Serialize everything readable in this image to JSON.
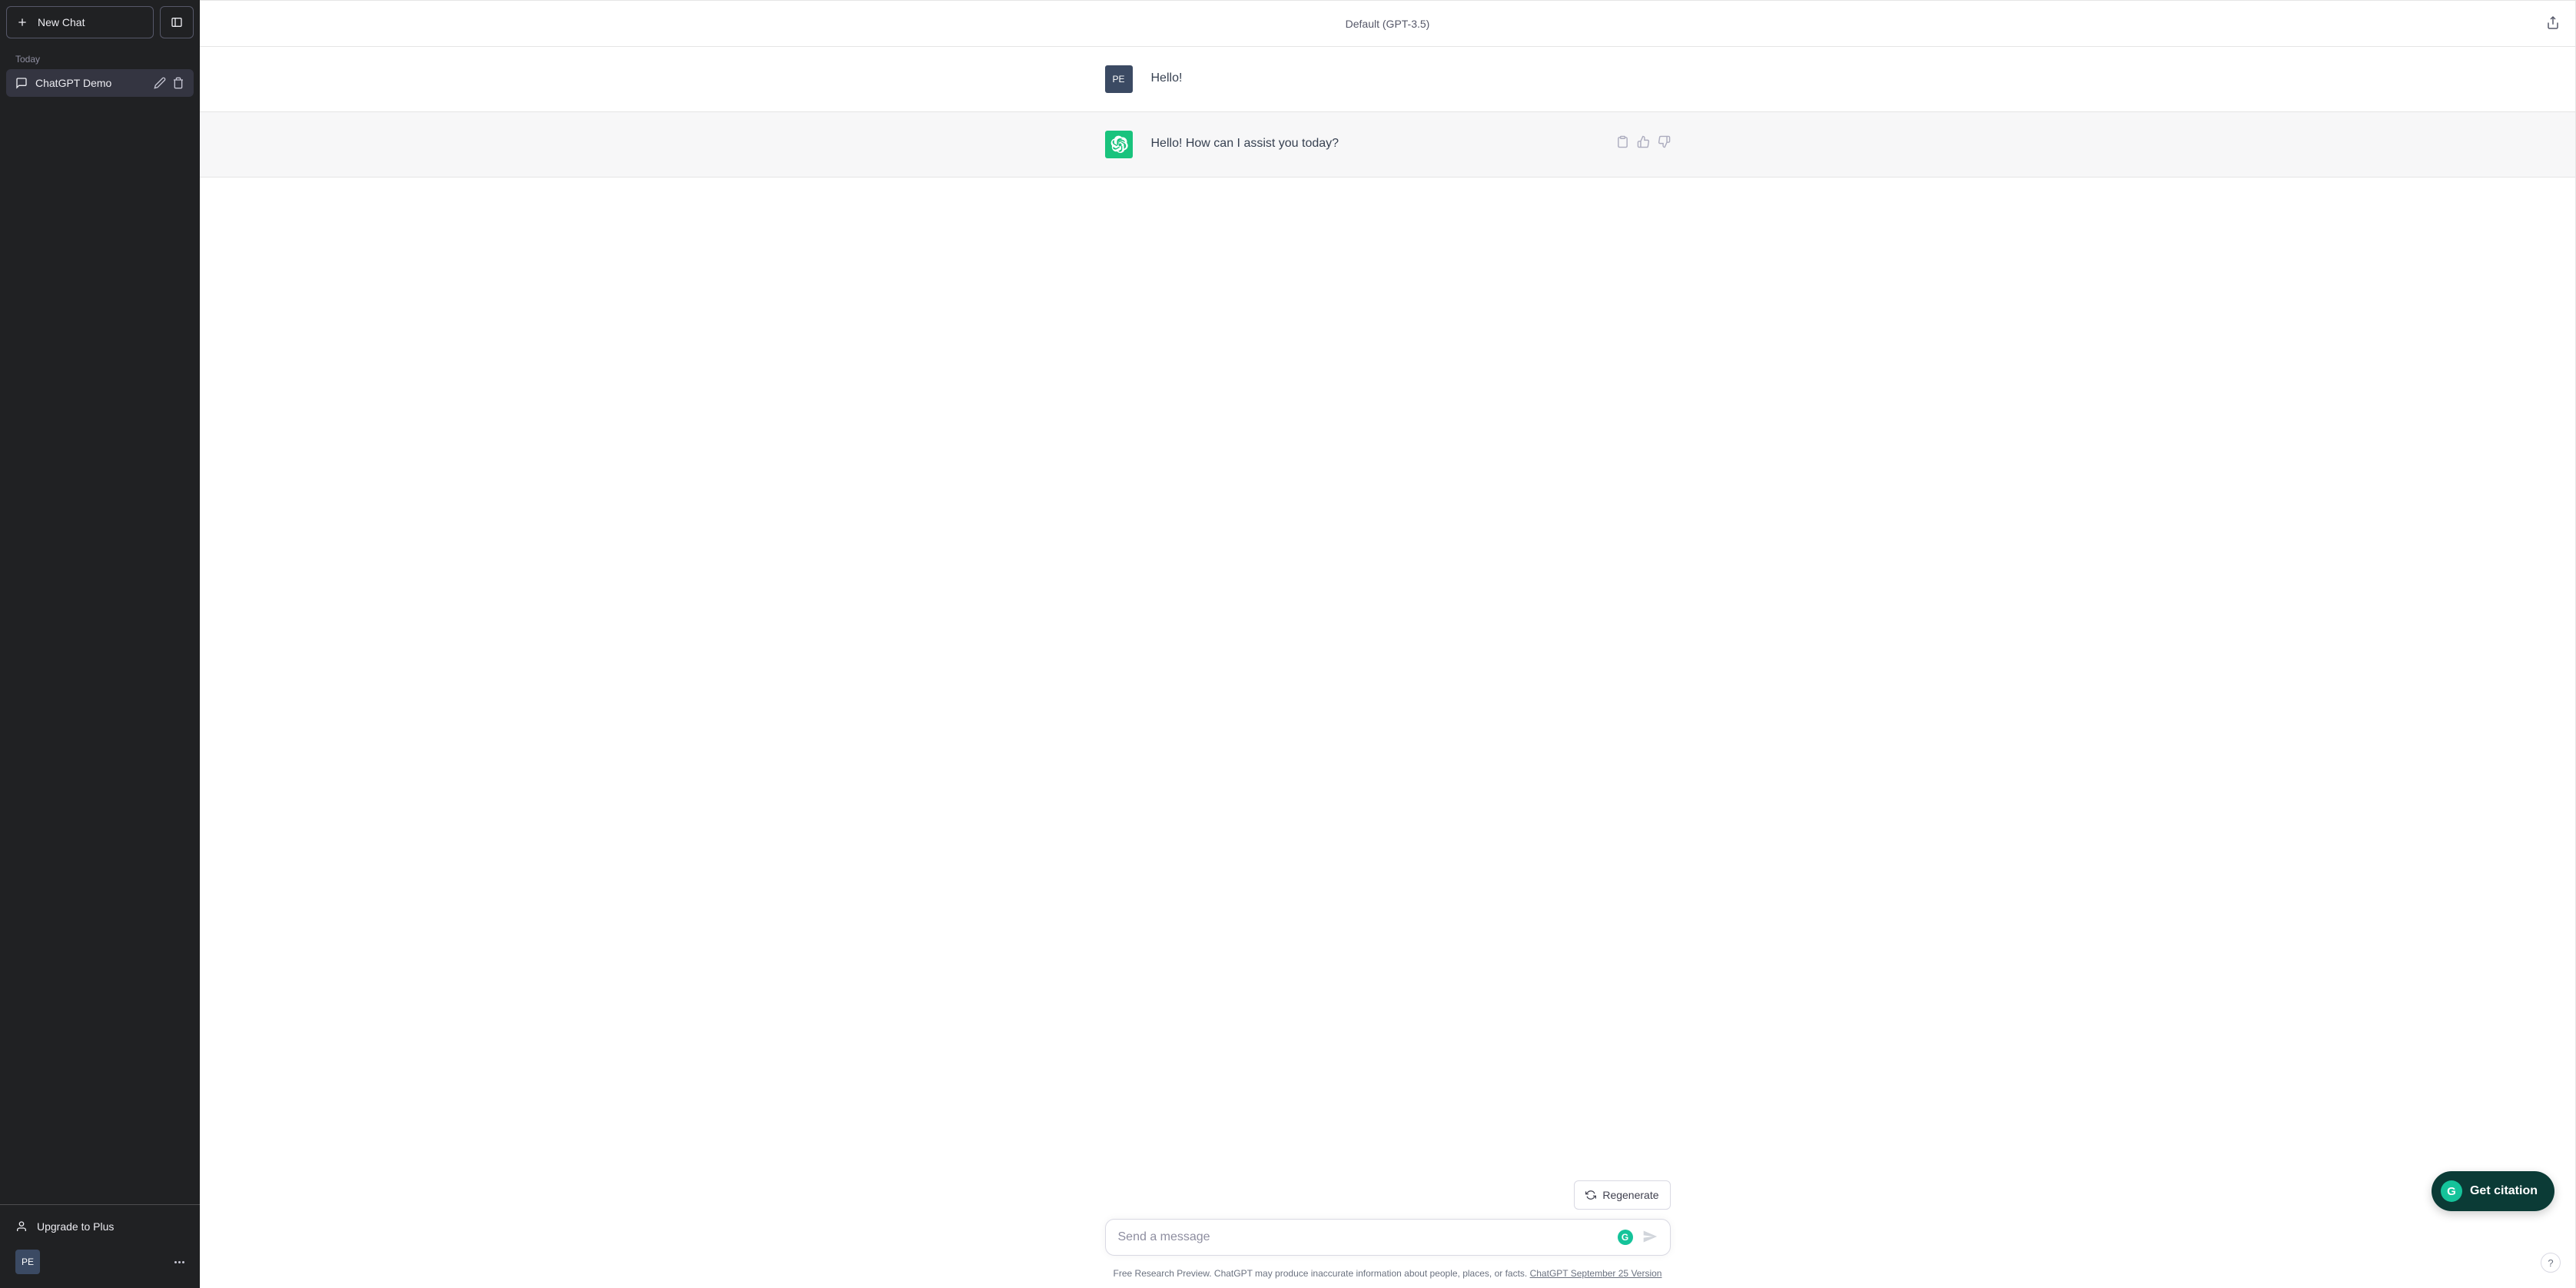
{
  "sidebar": {
    "new_chat_label": "New Chat",
    "history_section": "Today",
    "history_items": [
      {
        "title": "ChatGPT Demo"
      }
    ],
    "upgrade_label": "Upgrade to Plus",
    "user_initials": "PE"
  },
  "header": {
    "model": "Default (GPT-3.5)"
  },
  "messages": {
    "user_initials": "PE",
    "user_text": "Hello!",
    "assistant_text": "Hello! How can I assist you today?"
  },
  "controls": {
    "regenerate_label": "Regenerate",
    "input_placeholder": "Send a message"
  },
  "footer": {
    "note_prefix": "Free Research Preview. ChatGPT may produce inaccurate information about people, places, or facts. ",
    "version_link": "ChatGPT September 25 Version"
  },
  "floaters": {
    "citation_label": "Get citation",
    "citation_badge": "G",
    "help_label": "?",
    "grammarly_badge": "G"
  }
}
